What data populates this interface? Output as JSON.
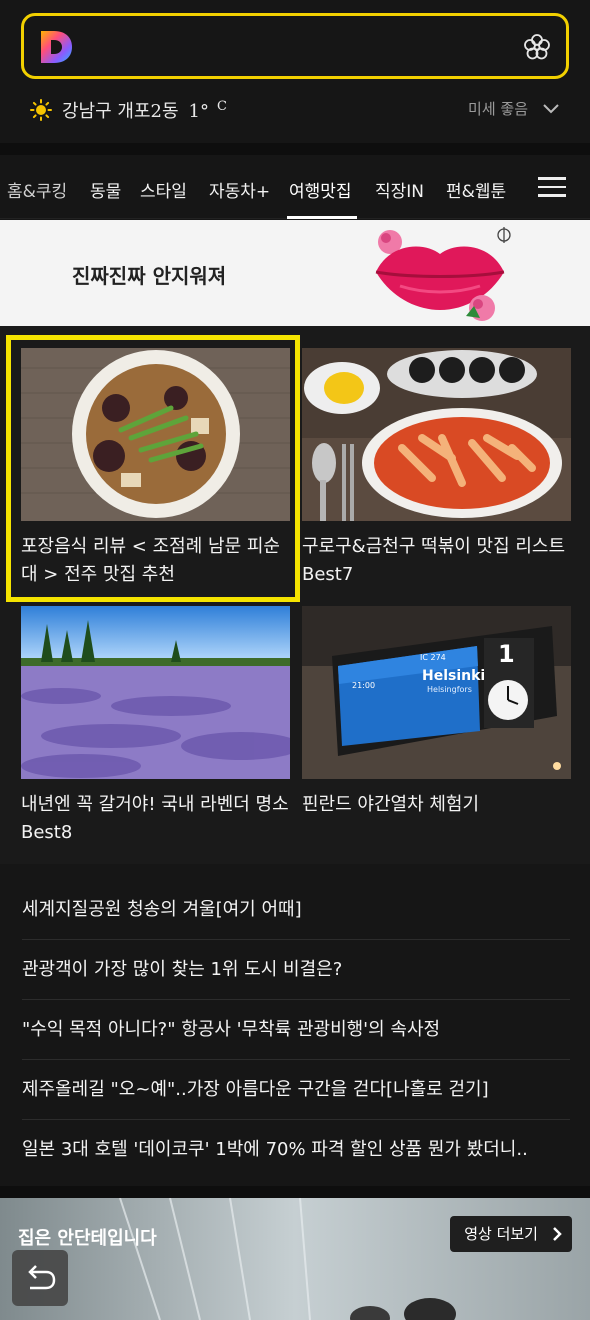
{
  "header": {
    "logo_icon": "daum-d-logo",
    "flower_icon": "flower-icon"
  },
  "weather": {
    "location": "강남구 개포2동",
    "temp": "1°",
    "unit": "C",
    "dust_label": "미세 좋음"
  },
  "tabs": [
    {
      "label": "홈&쿠킹"
    },
    {
      "label": "동물"
    },
    {
      "label": "스타일"
    },
    {
      "label": "자동차+"
    },
    {
      "label": "여행맛집"
    },
    {
      "label": "직장IN"
    },
    {
      "label": "편&웹툰"
    }
  ],
  "ad": {
    "headline": "진짜진짜 안지워져"
  },
  "cards": [
    {
      "title": "포장음식 리뷰 < 조점례 남문 피순대 > 전주 맛집 추천"
    },
    {
      "title": "구로구&금천구 떡볶이 맛집 리스트 Best7"
    },
    {
      "title": "내년엔 꼭 갈거야! 국내 라벤더 명소 Best8"
    },
    {
      "title": "핀란드 야간열차 체험기"
    }
  ],
  "train_board": {
    "train": "IC 274",
    "city": "Helsinki",
    "city_alt": "Helsingfors",
    "time": "21:00",
    "track": "1"
  },
  "list": [
    {
      "title": "세계지질공원 청송의 겨울[여기 어때]"
    },
    {
      "title": "관광객이 가장 많이 찾는 1위 도시 비결은?"
    },
    {
      "title": "\"수익 목적 아니다?\" 항공사 '무착륙 관광비행'의 속사정"
    },
    {
      "title": "제주올레길 \"오~예\"..가장 아름다운 구간을 걷다[나홀로 걷기]"
    },
    {
      "title": "일본 3대 호텔 '데이코쿠' 1박에 70% 파격 할인 상품 뭔가 봤더니.."
    }
  ],
  "video": {
    "title": "집은 안단테입니다",
    "more_label": "영상 더보기"
  },
  "colors": {
    "background": "#161616",
    "highlight": "#f5e400",
    "search_border": "#f2d000"
  }
}
